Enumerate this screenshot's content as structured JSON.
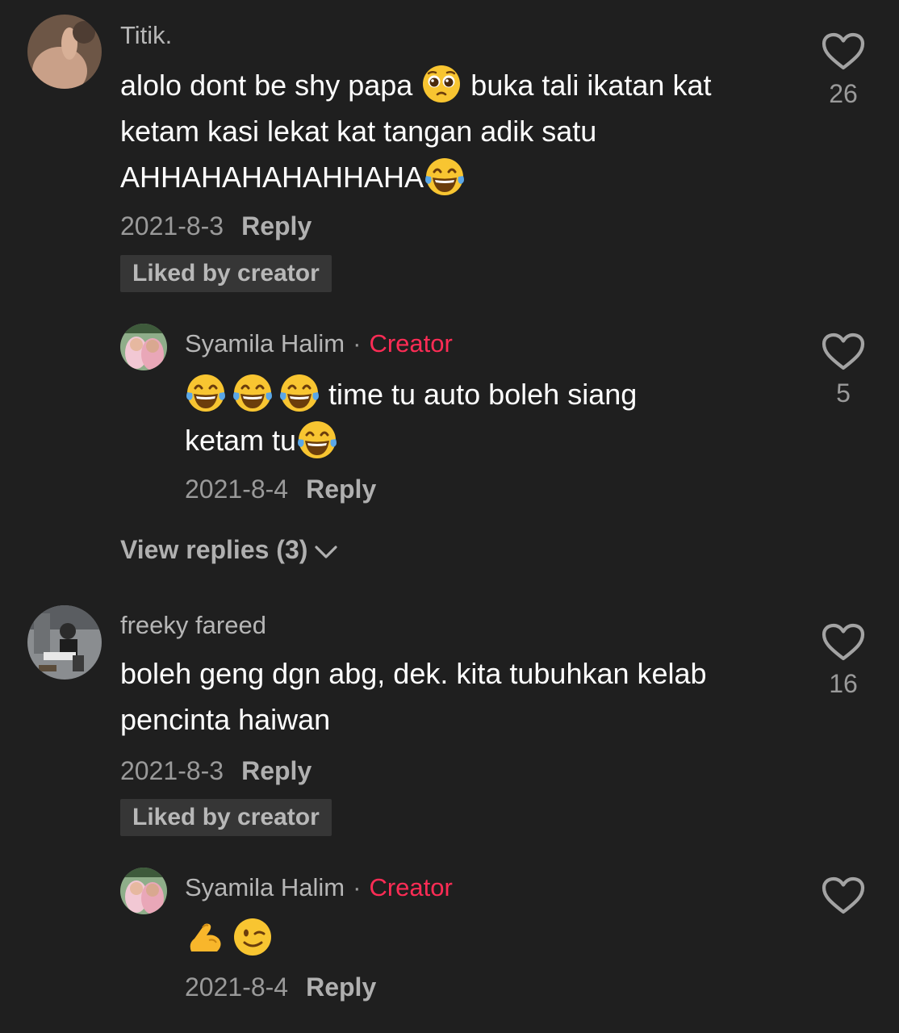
{
  "comments": [
    {
      "username": "Titik.",
      "text_parts": [
        "alolo dont be shy papa ",
        " buka tali ikatan kat ketam kasi lekat kat tangan adik satu AHHAHAHAHAHHAHA"
      ],
      "emoji": [
        "pleading-face",
        "tears-of-joy"
      ],
      "date": "2021-8-3",
      "reply_label": "Reply",
      "liked_badge": "Liked by creator",
      "likes": "26",
      "reply": {
        "username": "Syamila Halim",
        "separator": "·",
        "creator_label": "Creator",
        "text_parts": [
          " time tu auto boleh siang",
          "ketam tu"
        ],
        "emoji": [
          "tears-of-joy",
          "tears-of-joy",
          "tears-of-joy",
          "tears-of-joy"
        ],
        "date": "2021-8-4",
        "reply_label": "Reply",
        "likes": "5"
      },
      "view_replies": "View replies (3)"
    },
    {
      "username": "freeky fareed",
      "text": "boleh geng dgn abg, dek. kita tubuhkan kelab pencinta haiwan",
      "date": "2021-8-3",
      "reply_label": "Reply",
      "liked_badge": "Liked by creator",
      "likes": "16",
      "reply": {
        "username": "Syamila Halim",
        "separator": "·",
        "creator_label": "Creator",
        "emoji": [
          "flexed-biceps",
          "winking-face"
        ],
        "date": "2021-8-4",
        "reply_label": "Reply"
      }
    }
  ],
  "colors": {
    "background": "#1f1f1f",
    "creator_accent": "#fe2c55",
    "badge_bg": "#363636",
    "muted_text": "#9a9a9a"
  }
}
